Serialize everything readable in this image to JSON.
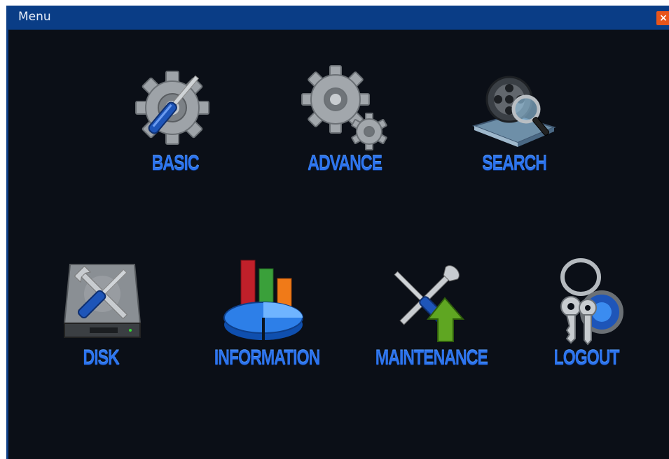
{
  "window": {
    "title": "Menu",
    "close_label": "×"
  },
  "menu": {
    "items": [
      {
        "label": "BASIC",
        "icon": "gear-screwdriver-icon"
      },
      {
        "label": "ADVANCE",
        "icon": "gears-icon"
      },
      {
        "label": "SEARCH",
        "icon": "film-reel-magnifier-icon"
      },
      {
        "label": "DISK",
        "icon": "hard-disk-tools-icon"
      },
      {
        "label": "INFORMATION",
        "icon": "chart-pie-icon"
      },
      {
        "label": "MAINTENANCE",
        "icon": "tools-upgrade-icon"
      },
      {
        "label": "LOGOUT",
        "icon": "keys-icon"
      }
    ]
  },
  "colors": {
    "background": "#0b0f17",
    "titlebar": "#0a3d86",
    "label": "#2d74ee",
    "close": "#e9551b"
  }
}
